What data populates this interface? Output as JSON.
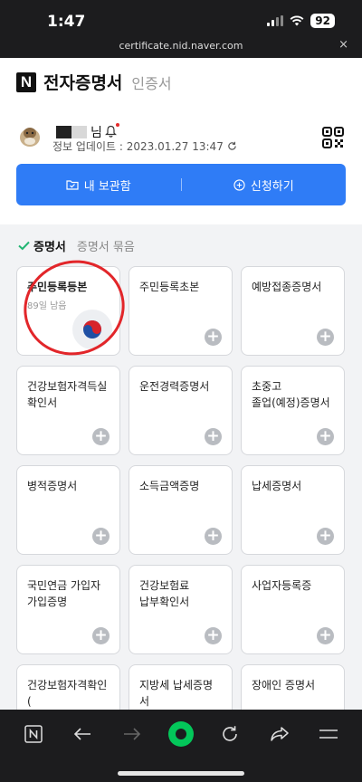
{
  "status_bar": {
    "time": "1:47",
    "battery": "92"
  },
  "browser": {
    "url": "certificate.nid.naver.com",
    "close_glyph": "×"
  },
  "header": {
    "logo_letter": "N",
    "title": "전자증명서",
    "subtitle": "인증서",
    "user_suffix": "님",
    "update_text": "정보 업데이트 : 2023.01.27 13:47"
  },
  "actions": {
    "storage_label": "내 보관함",
    "apply_label": "신청하기"
  },
  "tabs": {
    "active": "증명서",
    "inactive": "증명서 묶음"
  },
  "cards": [
    {
      "title": "주민등록등본",
      "sub": "89일 남음",
      "issued": true
    },
    {
      "title": "주민등록초본"
    },
    {
      "title": "예방접종증명서"
    },
    {
      "title": "건강보험자격득실\n확인서"
    },
    {
      "title": "운전경력증명서"
    },
    {
      "title": "초중고\n졸업(예정)증명서"
    },
    {
      "title": "병적증명서"
    },
    {
      "title": "소득금액증명"
    },
    {
      "title": "납세증명서"
    },
    {
      "title": "국민연금 가입자\n가입증명"
    },
    {
      "title": "건강보험료\n납부확인서"
    },
    {
      "title": "사업자등록증"
    },
    {
      "title": "건강보험자격확인(\n통보)서"
    },
    {
      "title": "지방세 납세증명서"
    },
    {
      "title": "장애인 증명서"
    }
  ],
  "bottom_nav": {
    "items": [
      "naver-home-icon",
      "back-arrow-icon",
      "forward-arrow-icon",
      "green-dot-icon",
      "reload-icon",
      "share-icon",
      "menu-icon"
    ]
  },
  "colors": {
    "primary": "#2f7cf6",
    "check": "#22b573",
    "highlight": "#e2262a",
    "green": "#03c75a"
  }
}
